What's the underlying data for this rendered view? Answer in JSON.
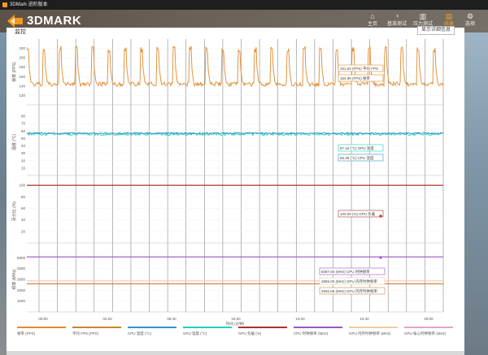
{
  "window": {
    "title": "3DMark 进阶版本"
  },
  "brand": {
    "logo_text": "3DMARK"
  },
  "nav": [
    {
      "label": "主页",
      "icon": "home-icon"
    },
    {
      "label": "基准测试",
      "icon": "gauge-icon"
    },
    {
      "label": "压力测试",
      "icon": "bar-chart-icon"
    },
    {
      "label": "结果",
      "icon": "results-icon",
      "active": true
    },
    {
      "label": "选项",
      "icon": "gear-icon"
    }
  ],
  "panel": {
    "header": "监控",
    "detail_button": "显示详细信息"
  },
  "colors": {
    "accent": "#f3a023",
    "fps": "#e08a2e",
    "gpu_temp": "#22d0bf",
    "gpu_load": "#a8322b",
    "cpu_clock": "#9a56c2",
    "gpu_mem_clock": "#f0c9a2",
    "gpu_core_clock": "#c98a4b"
  },
  "chart_data": [
    {
      "type": "line",
      "ylabel": "帧率 (FPS)",
      "ylim": [
        100,
        240
      ],
      "yticks": [
        "220",
        "200",
        "180",
        "160",
        "140",
        "120"
      ],
      "series": [
        {
          "name": "帧率 (FPS)",
          "color": "#e08a2e",
          "pattern": {
            "min": 135,
            "max": 225,
            "period": 20
          }
        }
      ],
      "annotations": [
        "151.63 (FPS) 平均 FPS",
        "154.99 (FPS) 帧率"
      ]
    },
    {
      "type": "line",
      "ylabel": "温度 (°C)",
      "ylim": [
        0,
        90
      ],
      "yticks": [
        "80",
        "70",
        "60",
        "50",
        "40",
        "30",
        "20",
        "10"
      ],
      "series": [
        {
          "name": "GPU 温度 (°C)",
          "color": "#22d0bf",
          "pattern": {
            "min": 54,
            "max": 58
          }
        },
        {
          "name": "CPU 温度 (°C)",
          "color": "#3a8fc8",
          "pattern": {
            "min": 56,
            "max": 58
          }
        }
      ],
      "annotations": [
        "57.16 (°C) GPU 温度",
        "55.36 (°C) CPU 温度"
      ]
    },
    {
      "type": "line",
      "ylabel": "百分比 (%)",
      "ylim": [
        0,
        110
      ],
      "yticks": [
        "100",
        "80",
        "60",
        "40",
        "20"
      ],
      "series": [
        {
          "name": "GPU 负载 (%)",
          "color": "#a8322b",
          "value": 100
        }
      ],
      "annotations": [
        "100.00 (%) GPU 负载"
      ]
    },
    {
      "type": "line",
      "ylabel": "频率 (MHz)",
      "ylim": [
        0,
        6000
      ],
      "yticks": [
        "5000",
        "4000",
        "3000",
        "2000",
        "1000"
      ],
      "series": [
        {
          "name": "CPU 时钟频率 (MHz)",
          "color": "#9a56c2",
          "value": 5087.5
        },
        {
          "name": "GPU 内存时钟频率 (MHz)",
          "color": "#f0c9a2",
          "value": 2865
        },
        {
          "name": "GPU 核心时钟频率 (MHz)",
          "color": "#c98a4b",
          "value": 2592.68
        }
      ],
      "annotations": [
        "5087.50 (MHz) CPU 时钟频率",
        "2865.00 (MHz) GPU 内存时钟频率",
        "2592.68 (MHz) GPU 内存时钟频率"
      ]
    }
  ],
  "time_axis": {
    "xlabel": "时间 (分钟)",
    "ticks": [
      "00:00",
      "03:20",
      "06:40",
      "10:00",
      "13:20",
      "16:40",
      "20:00"
    ]
  },
  "legend": [
    {
      "label": "帧率 (FPS)",
      "color": "#e08a2e"
    },
    {
      "label": "平均 FPS (FPS)",
      "color": "#c9852f"
    },
    {
      "label": "CPU 温度 (°C)",
      "color": "#3a8fc8"
    },
    {
      "label": "GPU 温度 (°C)",
      "color": "#22d0bf"
    },
    {
      "label": "GPU 负载 (%)",
      "color": "#a8322b"
    },
    {
      "label": "CPU 时钟频率 (MHz)",
      "color": "#9a56c2"
    },
    {
      "label": "GPU 内存时钟频率 (MHz)",
      "color": "#f0c9a2"
    },
    {
      "label": "GPU 核心时钟频率 (MHz)",
      "color": "#e0a6c8"
    }
  ]
}
